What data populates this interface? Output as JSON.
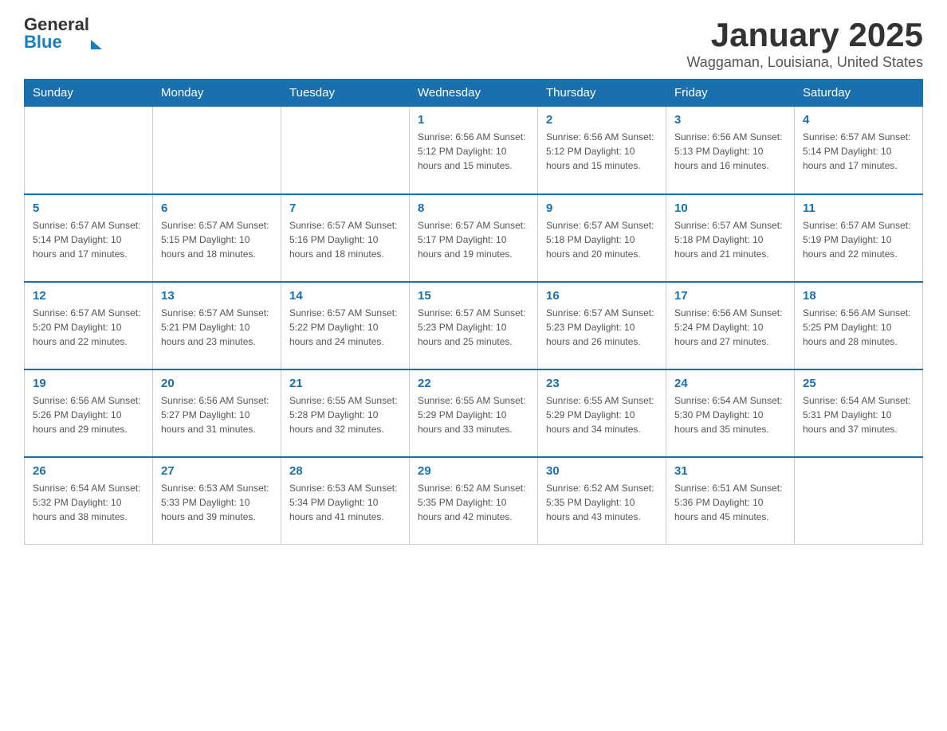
{
  "header": {
    "title": "January 2025",
    "subtitle": "Waggaman, Louisiana, United States",
    "logo_general": "General",
    "logo_blue": "Blue"
  },
  "days_of_week": [
    "Sunday",
    "Monday",
    "Tuesday",
    "Wednesday",
    "Thursday",
    "Friday",
    "Saturday"
  ],
  "weeks": [
    [
      {
        "day": "",
        "info": ""
      },
      {
        "day": "",
        "info": ""
      },
      {
        "day": "",
        "info": ""
      },
      {
        "day": "1",
        "info": "Sunrise: 6:56 AM\nSunset: 5:12 PM\nDaylight: 10 hours\nand 15 minutes."
      },
      {
        "day": "2",
        "info": "Sunrise: 6:56 AM\nSunset: 5:12 PM\nDaylight: 10 hours\nand 15 minutes."
      },
      {
        "day": "3",
        "info": "Sunrise: 6:56 AM\nSunset: 5:13 PM\nDaylight: 10 hours\nand 16 minutes."
      },
      {
        "day": "4",
        "info": "Sunrise: 6:57 AM\nSunset: 5:14 PM\nDaylight: 10 hours\nand 17 minutes."
      }
    ],
    [
      {
        "day": "5",
        "info": "Sunrise: 6:57 AM\nSunset: 5:14 PM\nDaylight: 10 hours\nand 17 minutes."
      },
      {
        "day": "6",
        "info": "Sunrise: 6:57 AM\nSunset: 5:15 PM\nDaylight: 10 hours\nand 18 minutes."
      },
      {
        "day": "7",
        "info": "Sunrise: 6:57 AM\nSunset: 5:16 PM\nDaylight: 10 hours\nand 18 minutes."
      },
      {
        "day": "8",
        "info": "Sunrise: 6:57 AM\nSunset: 5:17 PM\nDaylight: 10 hours\nand 19 minutes."
      },
      {
        "day": "9",
        "info": "Sunrise: 6:57 AM\nSunset: 5:18 PM\nDaylight: 10 hours\nand 20 minutes."
      },
      {
        "day": "10",
        "info": "Sunrise: 6:57 AM\nSunset: 5:18 PM\nDaylight: 10 hours\nand 21 minutes."
      },
      {
        "day": "11",
        "info": "Sunrise: 6:57 AM\nSunset: 5:19 PM\nDaylight: 10 hours\nand 22 minutes."
      }
    ],
    [
      {
        "day": "12",
        "info": "Sunrise: 6:57 AM\nSunset: 5:20 PM\nDaylight: 10 hours\nand 22 minutes."
      },
      {
        "day": "13",
        "info": "Sunrise: 6:57 AM\nSunset: 5:21 PM\nDaylight: 10 hours\nand 23 minutes."
      },
      {
        "day": "14",
        "info": "Sunrise: 6:57 AM\nSunset: 5:22 PM\nDaylight: 10 hours\nand 24 minutes."
      },
      {
        "day": "15",
        "info": "Sunrise: 6:57 AM\nSunset: 5:23 PM\nDaylight: 10 hours\nand 25 minutes."
      },
      {
        "day": "16",
        "info": "Sunrise: 6:57 AM\nSunset: 5:23 PM\nDaylight: 10 hours\nand 26 minutes."
      },
      {
        "day": "17",
        "info": "Sunrise: 6:56 AM\nSunset: 5:24 PM\nDaylight: 10 hours\nand 27 minutes."
      },
      {
        "day": "18",
        "info": "Sunrise: 6:56 AM\nSunset: 5:25 PM\nDaylight: 10 hours\nand 28 minutes."
      }
    ],
    [
      {
        "day": "19",
        "info": "Sunrise: 6:56 AM\nSunset: 5:26 PM\nDaylight: 10 hours\nand 29 minutes."
      },
      {
        "day": "20",
        "info": "Sunrise: 6:56 AM\nSunset: 5:27 PM\nDaylight: 10 hours\nand 31 minutes."
      },
      {
        "day": "21",
        "info": "Sunrise: 6:55 AM\nSunset: 5:28 PM\nDaylight: 10 hours\nand 32 minutes."
      },
      {
        "day": "22",
        "info": "Sunrise: 6:55 AM\nSunset: 5:29 PM\nDaylight: 10 hours\nand 33 minutes."
      },
      {
        "day": "23",
        "info": "Sunrise: 6:55 AM\nSunset: 5:29 PM\nDaylight: 10 hours\nand 34 minutes."
      },
      {
        "day": "24",
        "info": "Sunrise: 6:54 AM\nSunset: 5:30 PM\nDaylight: 10 hours\nand 35 minutes."
      },
      {
        "day": "25",
        "info": "Sunrise: 6:54 AM\nSunset: 5:31 PM\nDaylight: 10 hours\nand 37 minutes."
      }
    ],
    [
      {
        "day": "26",
        "info": "Sunrise: 6:54 AM\nSunset: 5:32 PM\nDaylight: 10 hours\nand 38 minutes."
      },
      {
        "day": "27",
        "info": "Sunrise: 6:53 AM\nSunset: 5:33 PM\nDaylight: 10 hours\nand 39 minutes."
      },
      {
        "day": "28",
        "info": "Sunrise: 6:53 AM\nSunset: 5:34 PM\nDaylight: 10 hours\nand 41 minutes."
      },
      {
        "day": "29",
        "info": "Sunrise: 6:52 AM\nSunset: 5:35 PM\nDaylight: 10 hours\nand 42 minutes."
      },
      {
        "day": "30",
        "info": "Sunrise: 6:52 AM\nSunset: 5:35 PM\nDaylight: 10 hours\nand 43 minutes."
      },
      {
        "day": "31",
        "info": "Sunrise: 6:51 AM\nSunset: 5:36 PM\nDaylight: 10 hours\nand 45 minutes."
      },
      {
        "day": "",
        "info": ""
      }
    ]
  ]
}
